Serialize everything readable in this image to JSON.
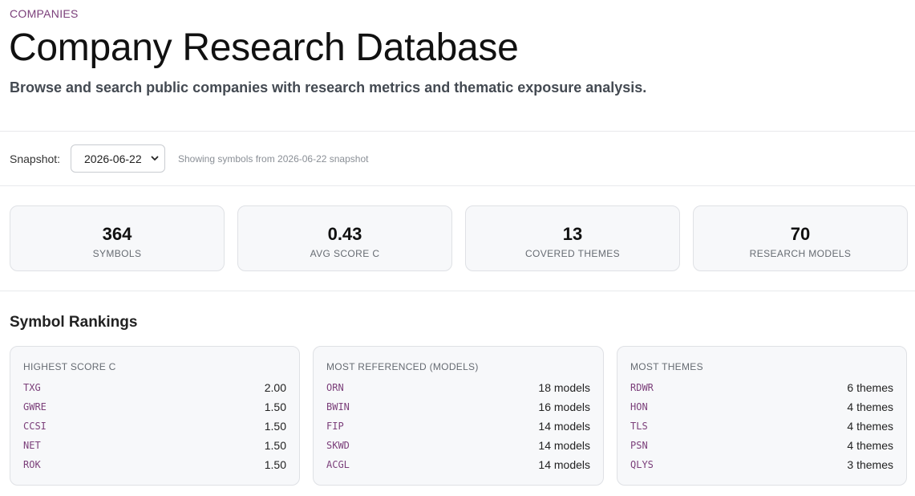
{
  "header": {
    "eyebrow": "COMPANIES",
    "title": "Company Research Database",
    "subtitle": "Browse and search public companies with research metrics and thematic exposure analysis."
  },
  "snapshot": {
    "label": "Snapshot:",
    "selected": "2026-06-22",
    "note": "Showing symbols from 2026-06-22 snapshot"
  },
  "stats": [
    {
      "value": "364",
      "label": "SYMBOLS"
    },
    {
      "value": "0.43",
      "label": "AVG SCORE C"
    },
    {
      "value": "13",
      "label": "COVERED THEMES"
    },
    {
      "value": "70",
      "label": "RESEARCH MODELS"
    }
  ],
  "rankings": {
    "title": "Symbol Rankings",
    "cards": [
      {
        "heading": "HIGHEST SCORE C",
        "rows": [
          {
            "symbol": "TXG",
            "value": "2.00"
          },
          {
            "symbol": "GWRE",
            "value": "1.50"
          },
          {
            "symbol": "CCSI",
            "value": "1.50"
          },
          {
            "symbol": "NET",
            "value": "1.50"
          },
          {
            "symbol": "ROK",
            "value": "1.50"
          }
        ]
      },
      {
        "heading": "MOST REFERENCED (MODELS)",
        "rows": [
          {
            "symbol": "ORN",
            "value": "18 models"
          },
          {
            "symbol": "BWIN",
            "value": "16 models"
          },
          {
            "symbol": "FIP",
            "value": "14 models"
          },
          {
            "symbol": "SKWD",
            "value": "14 models"
          },
          {
            "symbol": "ACGL",
            "value": "14 models"
          }
        ]
      },
      {
        "heading": "MOST THEMES",
        "rows": [
          {
            "symbol": "RDWR",
            "value": "6 themes"
          },
          {
            "symbol": "HON",
            "value": "4 themes"
          },
          {
            "symbol": "TLS",
            "value": "4 themes"
          },
          {
            "symbol": "PSN",
            "value": "4 themes"
          },
          {
            "symbol": "QLYS",
            "value": "3 themes"
          }
        ]
      }
    ]
  }
}
